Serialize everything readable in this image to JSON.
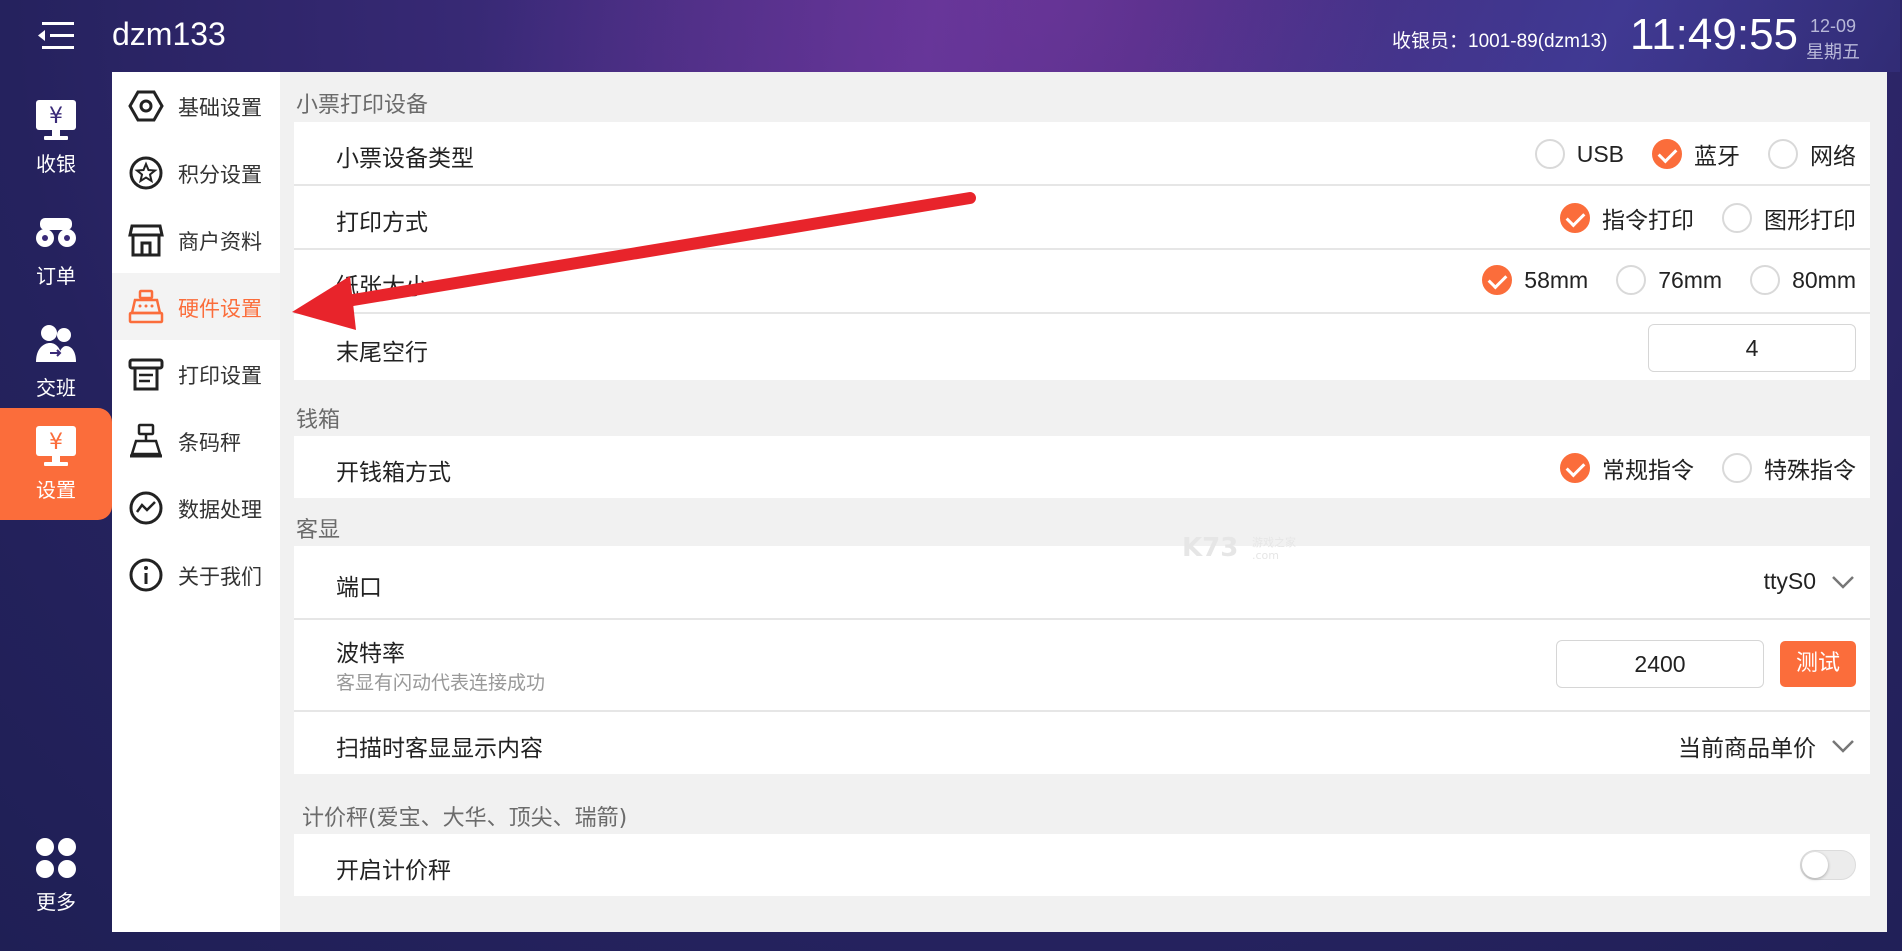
{
  "app_title": "dzm133",
  "header": {
    "cashier": "收银员：1001-89(dzm13)",
    "time": "11:49:55",
    "date": "12-09",
    "weekday": "星期五"
  },
  "left_nav": {
    "items": [
      {
        "label": "收银",
        "icon": "cashier-icon"
      },
      {
        "label": "订单",
        "icon": "order-icon"
      },
      {
        "label": "交班",
        "icon": "shift-icon"
      },
      {
        "label": "设置",
        "icon": "settings-icon"
      }
    ],
    "more": "更多"
  },
  "settings_menu": {
    "items": [
      {
        "label": "基础设置",
        "icon": "hexagon-icon"
      },
      {
        "label": "积分设置",
        "icon": "star-icon"
      },
      {
        "label": "商户资料",
        "icon": "store-icon"
      },
      {
        "label": "硬件设置",
        "icon": "register-icon"
      },
      {
        "label": "打印设置",
        "icon": "printer-icon"
      },
      {
        "label": "条码秤",
        "icon": "scale-icon"
      },
      {
        "label": "数据处理",
        "icon": "chart-icon"
      },
      {
        "label": "关于我们",
        "icon": "info-icon"
      }
    ],
    "active": "硬件设置"
  },
  "receipt_printer": {
    "section": "小票打印设备",
    "device_type": {
      "label": "小票设备类型",
      "options": [
        "USB",
        "蓝牙",
        "网络"
      ],
      "selected": "蓝牙"
    },
    "print_mode": {
      "label": "打印方式",
      "options": [
        "指令打印",
        "图形打印"
      ],
      "selected": "指令打印"
    },
    "paper_size": {
      "label": "纸张大小",
      "options": [
        "58mm",
        "76mm",
        "80mm"
      ],
      "selected": "58mm"
    },
    "tail_lines": {
      "label": "末尾空行",
      "value": "4"
    }
  },
  "cash_drawer": {
    "section": "钱箱",
    "open_mode": {
      "label": "开钱箱方式",
      "options": [
        "常规指令",
        "特殊指令"
      ],
      "selected": "常规指令"
    }
  },
  "customer_display": {
    "section": "客显",
    "port": {
      "label": "端口",
      "value": "ttyS0"
    },
    "baud": {
      "label": "波特率",
      "hint": "客显有闪动代表连接成功",
      "value": "2400",
      "test_button": "测试"
    },
    "scan_content": {
      "label": "扫描时客显显示内容",
      "value": "当前商品单价"
    }
  },
  "price_scale": {
    "section": "计价秤(爱宝、大华、顶尖、瑞箭)",
    "enable": {
      "label": "开启计价秤",
      "on": false
    }
  },
  "colors": {
    "accent": "#fb6d3b",
    "active_nav": "#fb6d3b",
    "annotation_arrow": "#e8242b"
  }
}
